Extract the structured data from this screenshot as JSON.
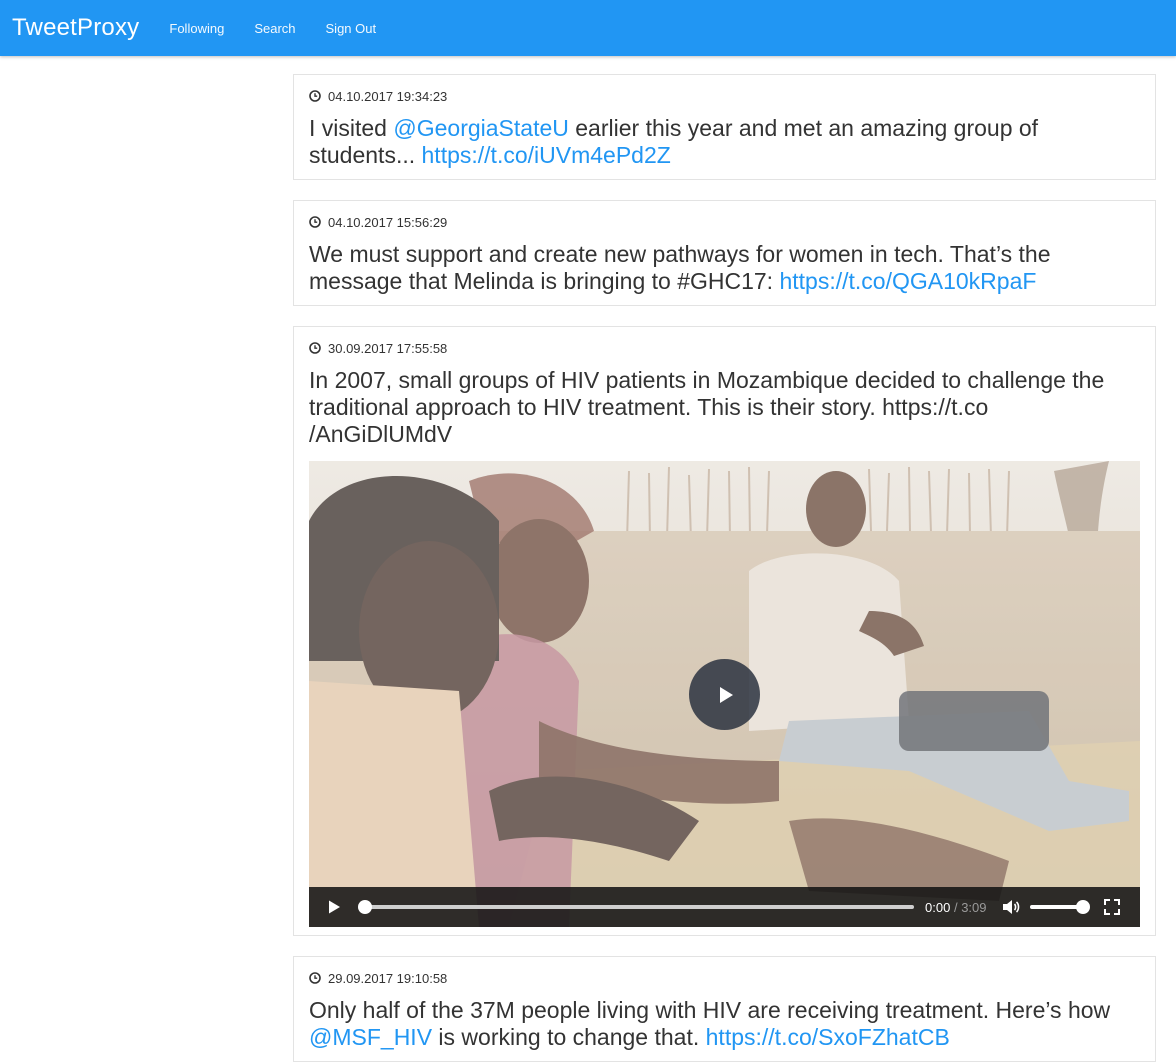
{
  "navbar": {
    "brand": "TweetProxy",
    "links": [
      "Following",
      "Search",
      "Sign Out"
    ]
  },
  "colors": {
    "accent": "#2196f3",
    "text": "#333333",
    "card_border": "#e3e3e3"
  },
  "tweets": [
    {
      "timestamp": "04.10.2017 19:34:23",
      "parts": [
        "I visited ",
        "@GeorgiaStateU",
        " earlier this year and met an amazing group of students... ",
        "https://t.co/iUVm4ePd2Z"
      ]
    },
    {
      "timestamp": "04.10.2017 15:56:29",
      "parts": [
        "We must support and create new pathways for women in tech. That’s the message that Melinda is bringing to #GHC17: ",
        "https://t.co/QGA10kRpaF"
      ]
    },
    {
      "timestamp": "30.09.2017 17:55:58",
      "parts": [
        "In 2007, small groups of HIV patients in Mozambique decided to challenge the traditional approach to HIV treatment. This is their story. https://t.co",
        "/AnGiDlUMdV"
      ],
      "video": {
        "current_time": "0:00",
        "separator": "/",
        "duration": "3:09",
        "progress": 0,
        "volume": 1.0
      }
    },
    {
      "timestamp": "29.09.2017 19:10:58",
      "parts": [
        "Only half of the 37M people living with HIV are receiving treatment. Here’s how ",
        "@MSF_HIV",
        " is working to change that. ",
        "https://t.co/SxoFZhatCB"
      ]
    }
  ],
  "icons": {
    "timestamp": "clock-icon",
    "play": "play-icon",
    "volume": "volume-icon",
    "fullscreen": "fullscreen-icon"
  }
}
